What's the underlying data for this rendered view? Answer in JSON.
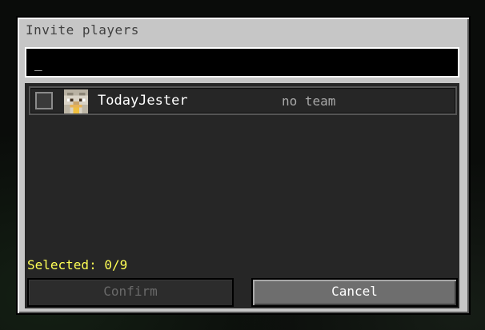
{
  "dialog": {
    "title": "Invite players",
    "search": {
      "value": "_"
    },
    "players": [
      {
        "name": "TodayJester",
        "team": "no team",
        "selected": false
      }
    ],
    "selected_label": "Selected: 0/9",
    "buttons": {
      "confirm": "Confirm",
      "cancel": "Cancel"
    }
  },
  "colors": {
    "dialog_bg": "#c6c6c6",
    "list_bg": "#262626",
    "selected_text": "#ffff55",
    "team_text": "#a8a8a8"
  },
  "icons": [
    "player-avatar-icon",
    "checkbox"
  ]
}
